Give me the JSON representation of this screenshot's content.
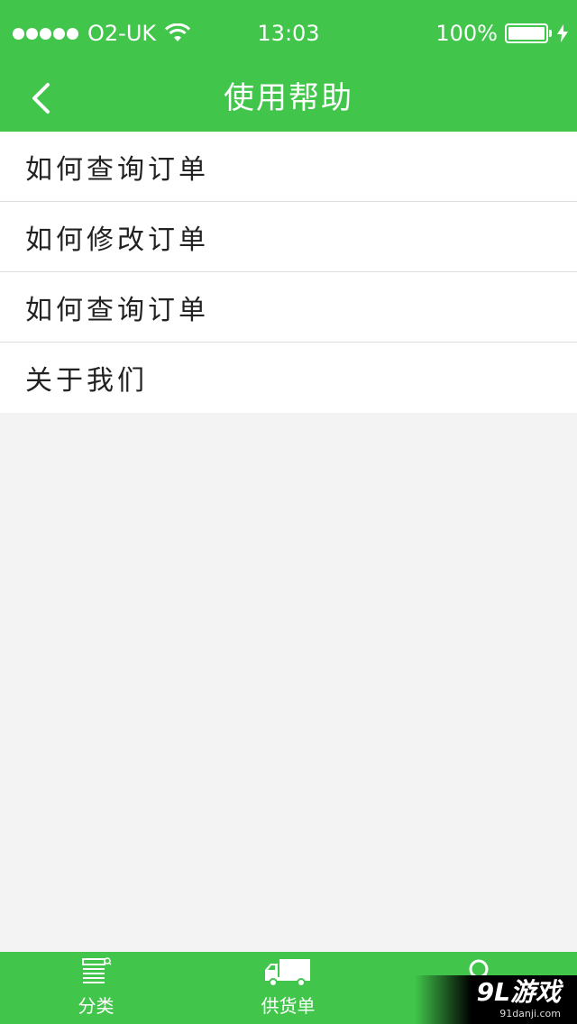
{
  "status_bar": {
    "carrier": "O2-UK",
    "time": "13:03",
    "battery": "100%"
  },
  "nav": {
    "title": "使用帮助"
  },
  "help_items": [
    "如何查询订单",
    "如何修改订单",
    "如何查询订单",
    "关于我们"
  ],
  "tab_bar": {
    "tabs": [
      {
        "label": "分类",
        "icon": "category-list-icon"
      },
      {
        "label": "供货单",
        "icon": "truck-icon"
      },
      {
        "label": "",
        "icon": "search-icon"
      }
    ]
  },
  "watermark": {
    "logo": "9L游戏",
    "url": "91danji.com"
  },
  "colors": {
    "primary": "#41c64b",
    "background": "#f3f3f3"
  }
}
